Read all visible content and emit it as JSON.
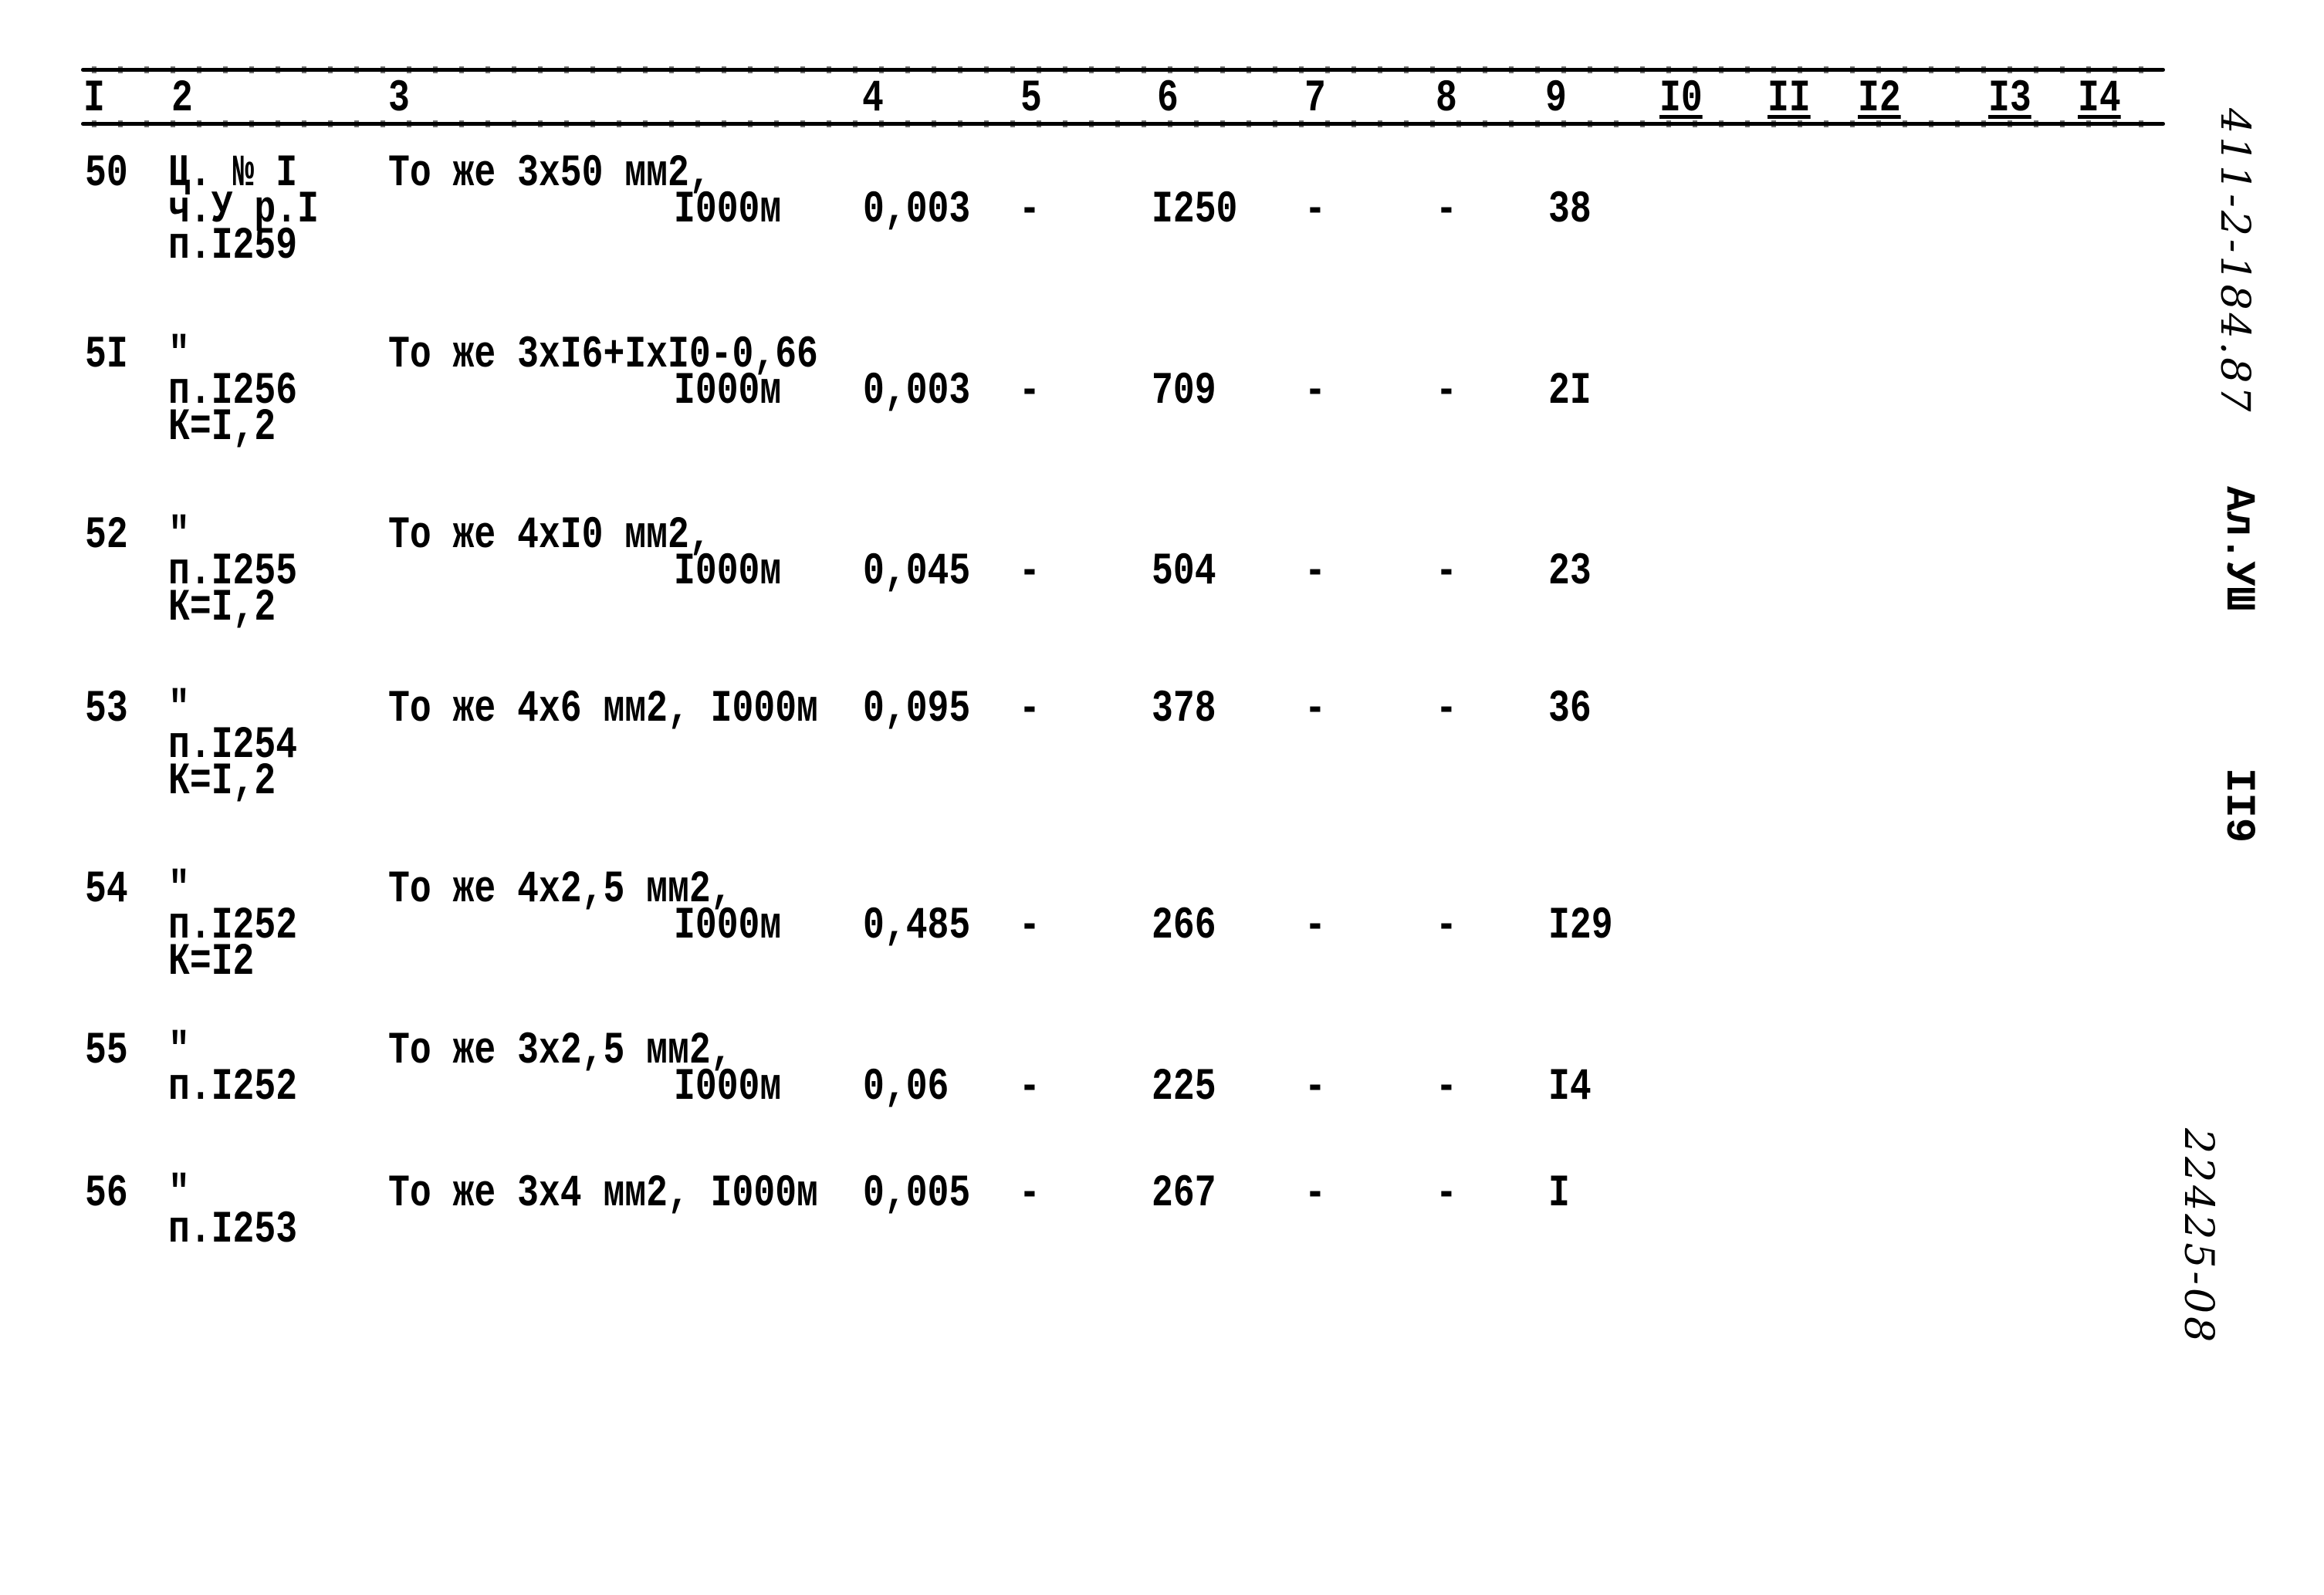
{
  "header": {
    "columns": [
      "I",
      "2",
      "3",
      "4",
      "5",
      "6",
      "7",
      "8",
      "9",
      "I0",
      "II",
      "I2",
      "I3",
      "I4"
    ]
  },
  "rows": [
    {
      "num": "50",
      "ref": [
        "Ц. № I",
        "ч.У р.I",
        "п.I259"
      ],
      "desc": "То же 3х50 мм2,",
      "desc_unit": "I000м",
      "values_line": 2,
      "c4": "0,003",
      "c5": "-",
      "c6": "I250",
      "c7": "-",
      "c8": "-",
      "c9": "38"
    },
    {
      "num": "5I",
      "ref": [
        "\"",
        "п.I256",
        "К=I,2"
      ],
      "desc": "То же 3хI6+IхI0-0,66",
      "desc_unit": "I000м",
      "values_line": 2,
      "c4": "0,003",
      "c5": "-",
      "c6": "709",
      "c7": "-",
      "c8": "-",
      "c9": "2I"
    },
    {
      "num": "52",
      "ref": [
        "\"",
        "п.I255",
        "К=I,2"
      ],
      "desc": "То же 4хI0 мм2,",
      "desc_unit": "I000м",
      "values_line": 2,
      "c4": "0,045",
      "c5": "-",
      "c6": "504",
      "c7": "-",
      "c8": "-",
      "c9": "23"
    },
    {
      "num": "53",
      "ref": [
        "\"",
        "п.I254",
        "К=I,2"
      ],
      "desc": "То же 4х6 мм2, I000м",
      "desc_unit": "",
      "values_line": 1,
      "c4": "0,095",
      "c5": "-",
      "c6": "378",
      "c7": "-",
      "c8": "-",
      "c9": "36"
    },
    {
      "num": "54",
      "ref": [
        "\"",
        "п.I252",
        "К=I2"
      ],
      "desc": "То же 4х2,5 мм2,",
      "desc_unit": "I000м",
      "values_line": 2,
      "c4": "0,485",
      "c5": "-",
      "c6": "266",
      "c7": "-",
      "c8": "-",
      "c9": "I29"
    },
    {
      "num": "55",
      "ref": [
        "\"",
        "п.I252"
      ],
      "desc": "То же 3х2,5 мм2,",
      "desc_unit": "I000м",
      "values_line": 2,
      "c4": "0,06",
      "c5": "-",
      "c6": "225",
      "c7": "-",
      "c8": "-",
      "c9": "I4"
    },
    {
      "num": "56",
      "ref": [
        "\"",
        "п.I253"
      ],
      "desc": "То же 3х4 мм2, I000м",
      "desc_unit": "",
      "values_line": 1,
      "c4": "0,005",
      "c5": "-",
      "c6": "267",
      "c7": "-",
      "c8": "-",
      "c9": "I"
    }
  ],
  "margin": {
    "doc_code": "411-2-184.87",
    "album": "Ал.УШ",
    "page": "II9",
    "inventory": "22425-08"
  }
}
